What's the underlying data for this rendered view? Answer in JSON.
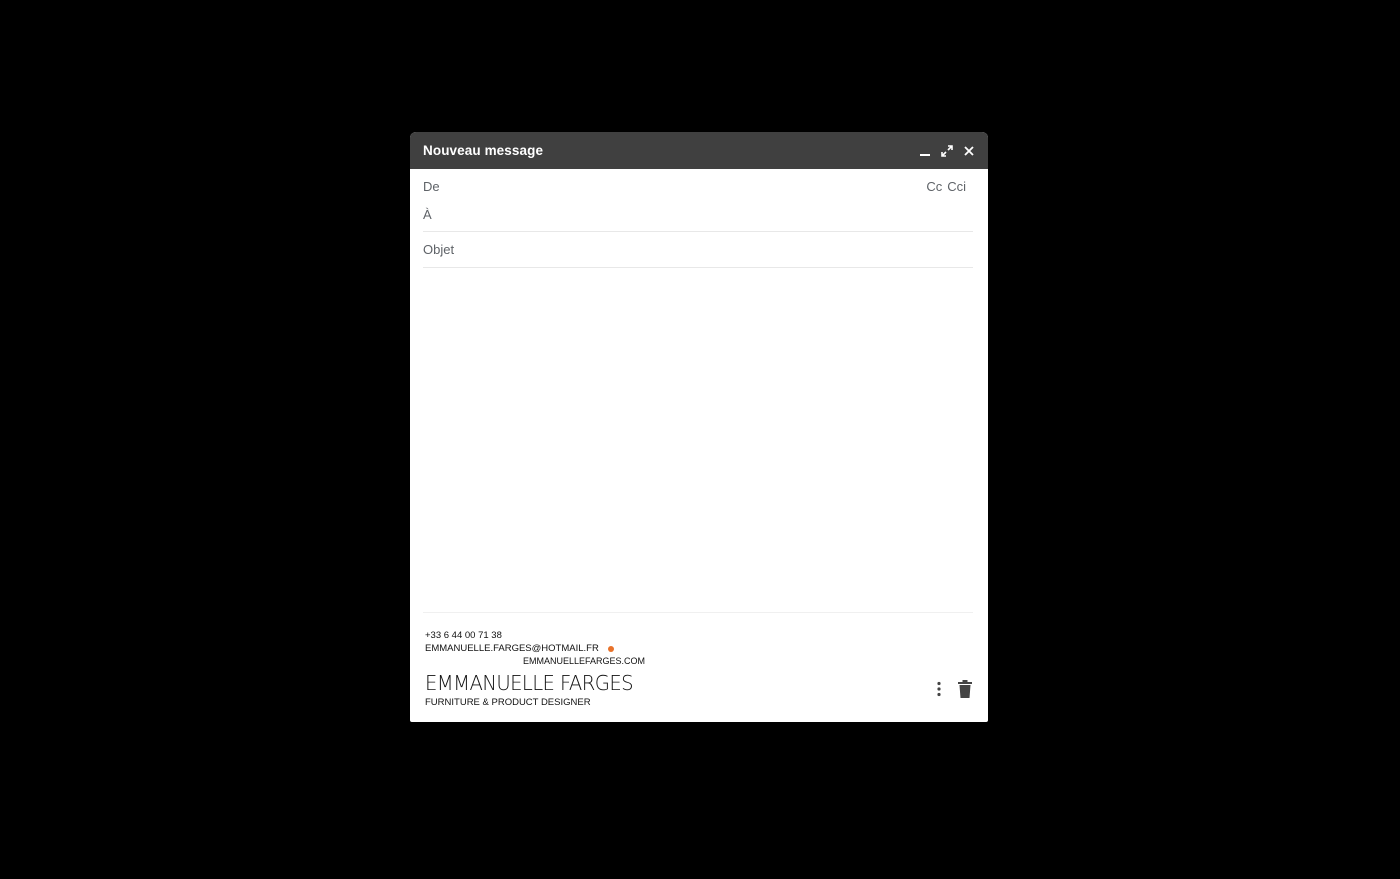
{
  "window": {
    "title": "Nouveau message",
    "controls": [
      "minimize-icon",
      "expand-icon",
      "close-icon"
    ]
  },
  "fields": {
    "from_label": "De",
    "to_label": "À",
    "subject_label": "Objet",
    "cc_label": "Cc",
    "bcc_label": "Cci"
  },
  "signature": {
    "phone": "+33 6 44 00 71 38",
    "email": "EMMANUELLE.FARGES@HOTMAIL.FR",
    "website": "EMMANUELLEFARGES.COM",
    "name": "EMMANUELLE FARGES",
    "tagline": "FURNITURE & PRODUCT DESIGNER",
    "accent_color": "#e8722a"
  },
  "footer": {
    "icons": [
      "more-options-icon",
      "trash-icon"
    ]
  },
  "colors": {
    "titlebar": "#404040",
    "background": "#000000"
  }
}
